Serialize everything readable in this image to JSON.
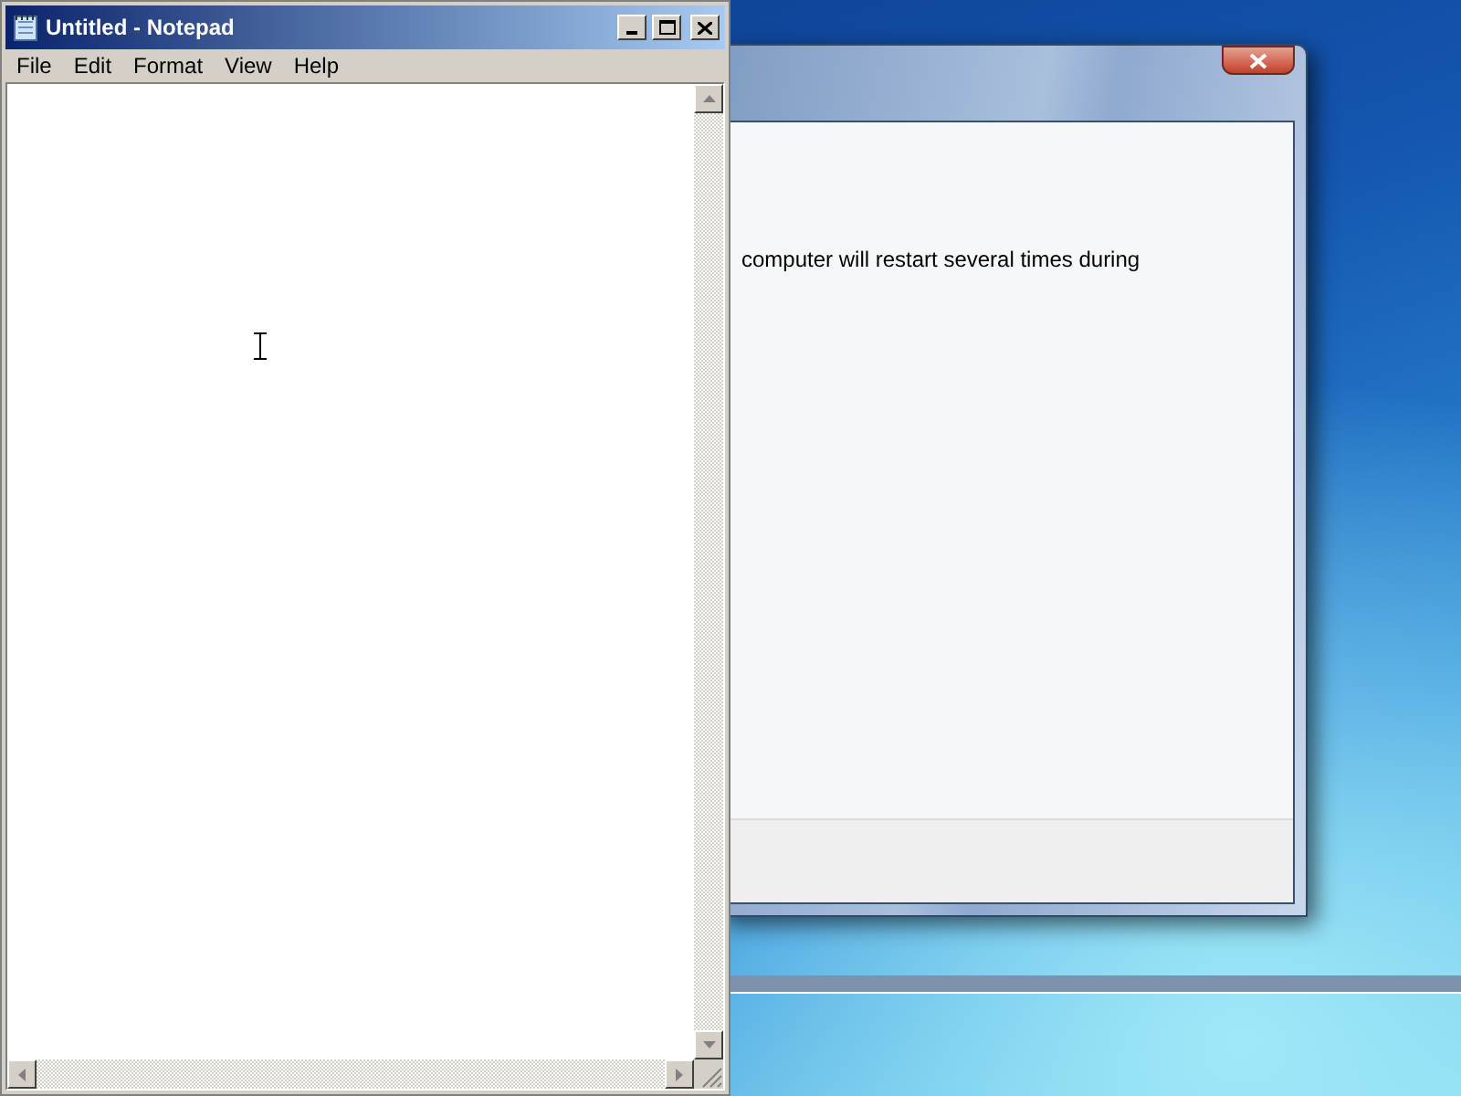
{
  "notepad": {
    "title": "Untitled - Notepad",
    "menu": [
      "File",
      "Edit",
      "Format",
      "View",
      "Help"
    ]
  },
  "setup_window": {
    "message": "computer will restart several times during"
  }
}
